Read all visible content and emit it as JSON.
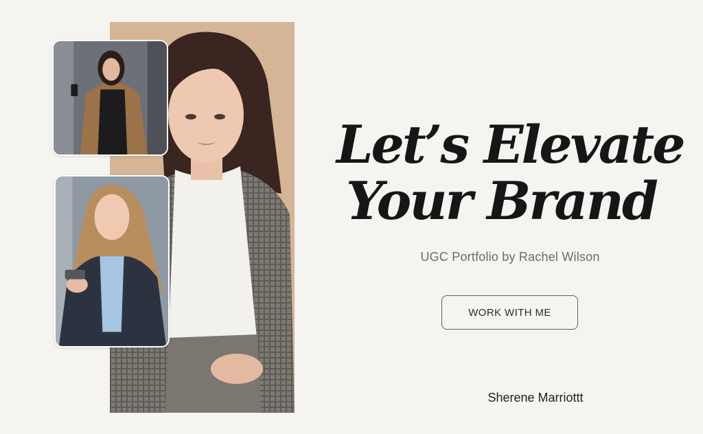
{
  "headline": {
    "line1": "Let’s Elevate",
    "line2": "Your Brand"
  },
  "subtitle": "UGC Portfolio by Rachel Wilson",
  "cta_label": "WORK WITH ME",
  "author": "Sherene Marriottt",
  "colors": {
    "background": "#f6f4f0",
    "headline": "#161616",
    "subtitle": "#6b6b6b",
    "button_border": "#5f5f5f"
  }
}
